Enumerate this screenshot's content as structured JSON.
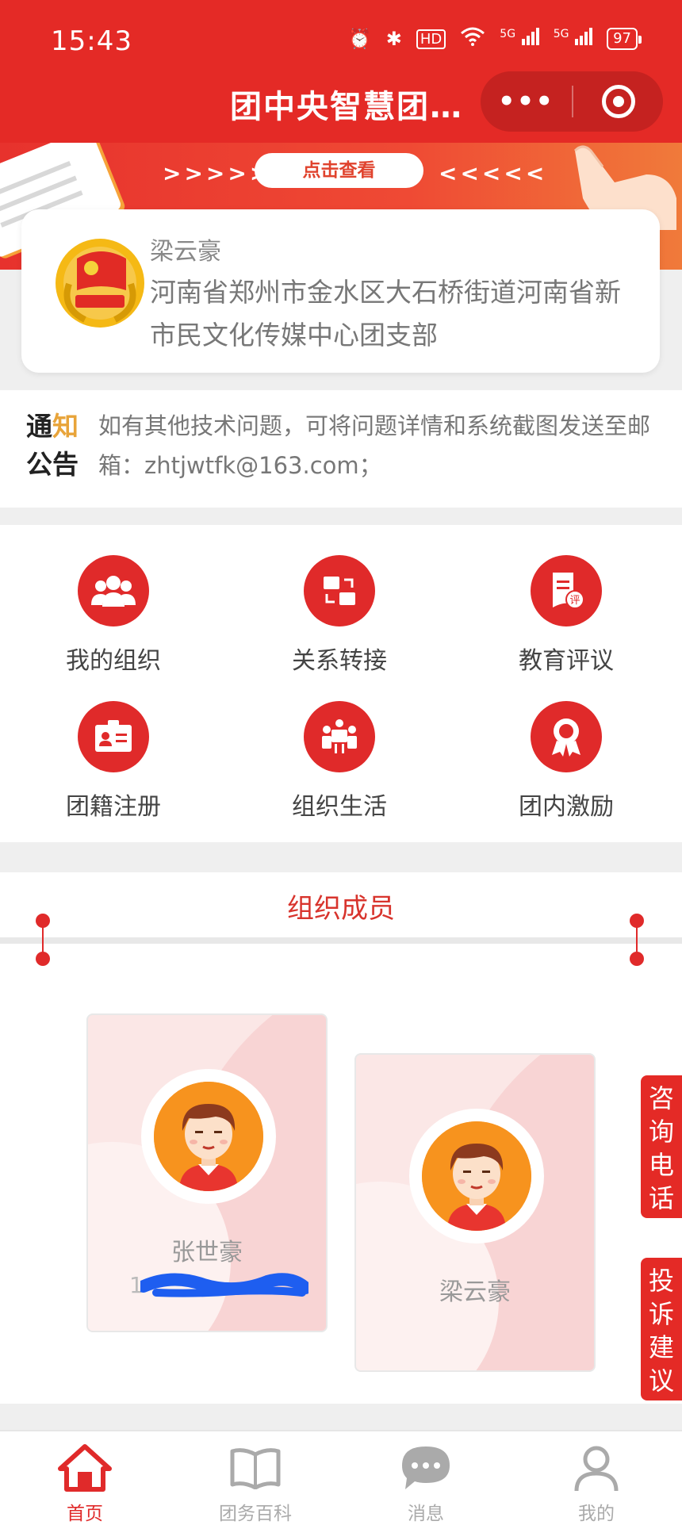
{
  "status_bar": {
    "time": "15:43",
    "battery": "97",
    "net1": "5G",
    "net2": "5G",
    "hd": "HD"
  },
  "app_bar": {
    "title": "团中央智慧团…",
    "more_label": "•••"
  },
  "banner": {
    "left_arrows": ">>>>>",
    "button": "点击查看",
    "right_arrows": "<<<<<"
  },
  "profile": {
    "name": "梁云豪",
    "org": "河南省郑州市金水区大石桥街道河南省新市民文化传媒中心团支部"
  },
  "notice": {
    "tag_line1_a": "通",
    "tag_line1_b": "知",
    "tag_line2": "公告",
    "text": "如有其他技术问题，可将问题详情和系统截图发送至邮箱：zhtjwtfk@163.com；"
  },
  "grid": [
    {
      "label": "我的组织",
      "icon": "users-icon"
    },
    {
      "label": "关系转接",
      "icon": "transfer-icon"
    },
    {
      "label": "教育评议",
      "icon": "review-icon"
    },
    {
      "label": "团籍注册",
      "icon": "id-card-icon"
    },
    {
      "label": "组织生活",
      "icon": "meeting-icon"
    },
    {
      "label": "团内激励",
      "icon": "award-icon"
    }
  ],
  "members": {
    "title": "组织成员",
    "list": [
      {
        "name": "张世豪",
        "phone": "1"
      },
      {
        "name": "梁云豪"
      }
    ]
  },
  "side_tabs": {
    "consult": "咨询电话",
    "complaint": "投诉建议"
  },
  "bottom_nav": [
    {
      "label": "首页",
      "icon": "home-icon",
      "active": true
    },
    {
      "label": "团务百科",
      "icon": "book-icon"
    },
    {
      "label": "消息",
      "icon": "message-icon"
    },
    {
      "label": "我的",
      "icon": "user-icon"
    }
  ],
  "colors": {
    "primary": "#e42a26",
    "accent": "#e02a2a",
    "text_gray": "#777777"
  }
}
